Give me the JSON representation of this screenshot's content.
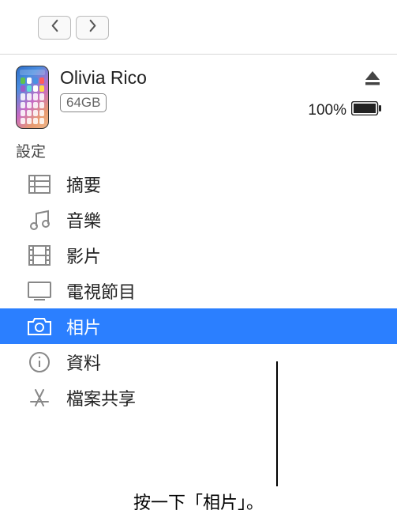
{
  "device": {
    "name": "Olivia Rico",
    "capacity": "64GB",
    "battery_pct": "100%"
  },
  "sidebar": {
    "section_label": "設定",
    "items": [
      {
        "label": "摘要"
      },
      {
        "label": "音樂"
      },
      {
        "label": "影片"
      },
      {
        "label": "電視節目"
      },
      {
        "label": "相片"
      },
      {
        "label": "資料"
      },
      {
        "label": "檔案共享"
      }
    ]
  },
  "caption": "按一下「相片」。"
}
